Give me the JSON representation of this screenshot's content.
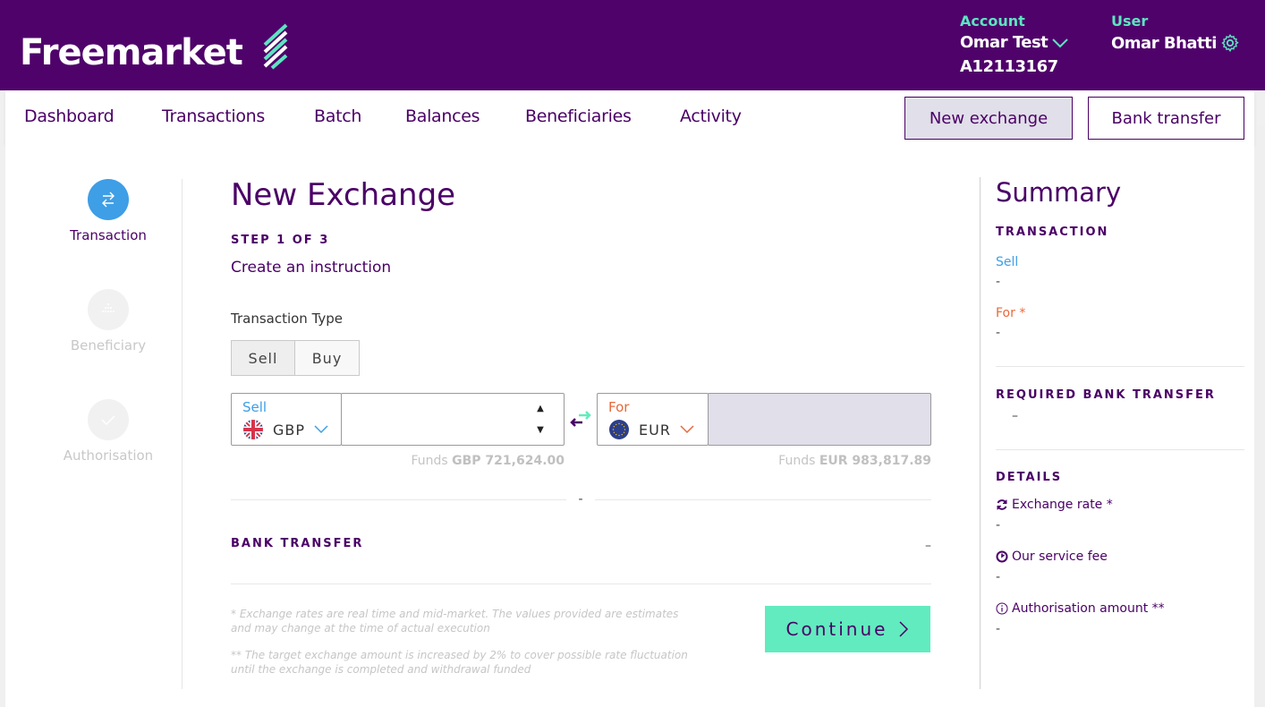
{
  "brand": {
    "name": "Freemarket",
    "primary": "#4f036a",
    "accent": "#5de4c1",
    "button_accent": "#62ebbf"
  },
  "header": {
    "account_label": "Account",
    "account_name": "Omar Test",
    "account_id": "A12113167",
    "user_label": "User",
    "user_name": "Omar Bhatti"
  },
  "nav": {
    "items": [
      {
        "label": "Dashboard"
      },
      {
        "label": "Transactions"
      },
      {
        "label": "Batch"
      },
      {
        "label": "Balances"
      },
      {
        "label": "Beneficiaries"
      },
      {
        "label": "Activity"
      }
    ],
    "new_exchange": "New exchange",
    "bank_transfer": "Bank transfer"
  },
  "stepper": {
    "steps": [
      {
        "label": "Transaction",
        "state": "active",
        "icon": "swap-arrows-icon"
      },
      {
        "label": "Beneficiary",
        "state": "inactive",
        "icon": "dots-icon"
      },
      {
        "label": "Authorisation",
        "state": "inactive",
        "icon": "check-icon"
      }
    ]
  },
  "main": {
    "title": "New Exchange",
    "step": "STEP 1 OF 3",
    "subtitle": "Create an instruction",
    "transaction_type_label": "Transaction Type",
    "transaction_types": [
      "Sell",
      "Buy"
    ],
    "selected_type": "Sell",
    "sell": {
      "label": "Sell",
      "currency": "GBP",
      "amount": "",
      "funds_prefix": "Funds",
      "funds_value": "GBP 721,624.00"
    },
    "for": {
      "label": "For",
      "currency": "EUR",
      "amount": "",
      "funds_prefix": "Funds",
      "funds_value": "EUR 983,817.89"
    },
    "rate_placeholder": "-",
    "bank_transfer_title": "BANK TRANSFER",
    "bank_transfer_value": "–",
    "note1": "* Exchange rates are real time and mid-market. The values provided are estimates and may change at the time of actual execution",
    "note2": "** The target exchange amount is increased by 2% to cover possible rate fluctuation until the exchange is completed and withdrawal funded",
    "continue_label": "Continue"
  },
  "summary": {
    "title": "Summary",
    "transaction_heading": "TRANSACTION",
    "sell_label": "Sell",
    "sell_value": "-",
    "for_label": "For *",
    "for_value": "-",
    "required_heading": "REQUIRED BANK TRANSFER",
    "required_value": "–",
    "details_heading": "DETAILS",
    "exchange_rate_label": "Exchange rate *",
    "exchange_rate_value": "-",
    "service_fee_label": "Our service fee",
    "service_fee_value": "-",
    "auth_amount_label": "Authorisation amount **",
    "auth_amount_value": "-"
  }
}
